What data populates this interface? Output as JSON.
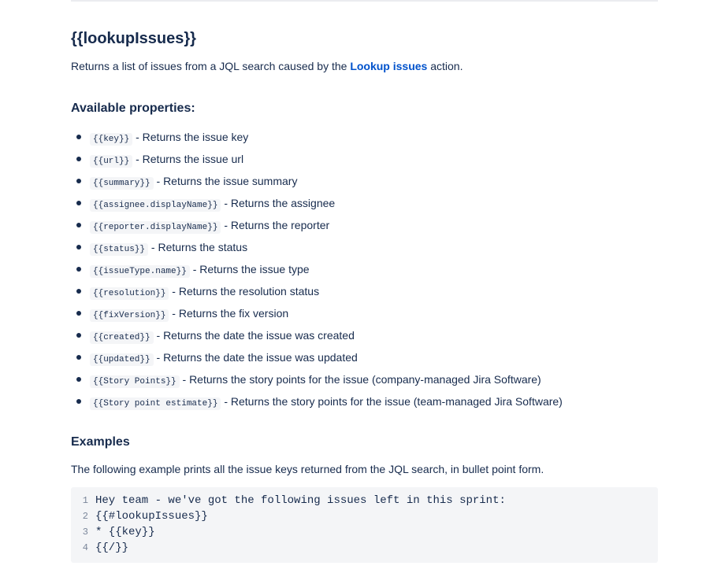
{
  "section": {
    "title": "{{lookupIssues}}",
    "intro_before": "Returns a list of issues from a JQL search caused by the ",
    "intro_link": "Lookup issues",
    "intro_after": " action."
  },
  "properties": {
    "heading": "Available properties:",
    "items": [
      {
        "code": "{{key}}",
        "desc": " - Returns the issue key"
      },
      {
        "code": "{{url}}",
        "desc": " - Returns the issue url"
      },
      {
        "code": "{{summary}}",
        "desc": " - Returns the issue summary"
      },
      {
        "code": "{{assignee.displayName}}",
        "desc": " -  Returns the assignee"
      },
      {
        "code": "{{reporter.displayName}}",
        "desc": " -  Returns the reporter"
      },
      {
        "code": "{{status}}",
        "desc": " - Returns the status"
      },
      {
        "code": "{{issueType.name}}",
        "desc": " - Returns the issue type"
      },
      {
        "code": "{{resolution}}",
        "desc": " - Returns the resolution status"
      },
      {
        "code": "{{fixVersion}}",
        "desc": " - Returns the fix version"
      },
      {
        "code": "{{created}}",
        "desc": " - Returns the date the issue was created"
      },
      {
        "code": "{{updated}}",
        "desc": " - Returns the date the issue was updated"
      },
      {
        "code": "{{Story Points}}",
        "desc": " - Returns the story points for the issue (company-managed Jira Software)"
      },
      {
        "code": "{{Story point estimate}}",
        "desc": " - Returns the story points for the issue (team-managed Jira Software)"
      }
    ]
  },
  "examples": {
    "heading": "Examples",
    "description": "The following example prints all the issue keys returned from the JQL search, in bullet point form.",
    "code_lines": [
      {
        "num": "1",
        "text": "Hey team - we've got the following issues left in this sprint:"
      },
      {
        "num": "2",
        "text": "{{#lookupIssues}}"
      },
      {
        "num": "3",
        "text": "* {{key}}"
      },
      {
        "num": "4",
        "text": "{{/}}"
      }
    ]
  },
  "colors": {
    "text": "#172b4d",
    "link": "#0052cc",
    "code_bg": "#f4f5f7",
    "line_number": "#7a869a"
  }
}
